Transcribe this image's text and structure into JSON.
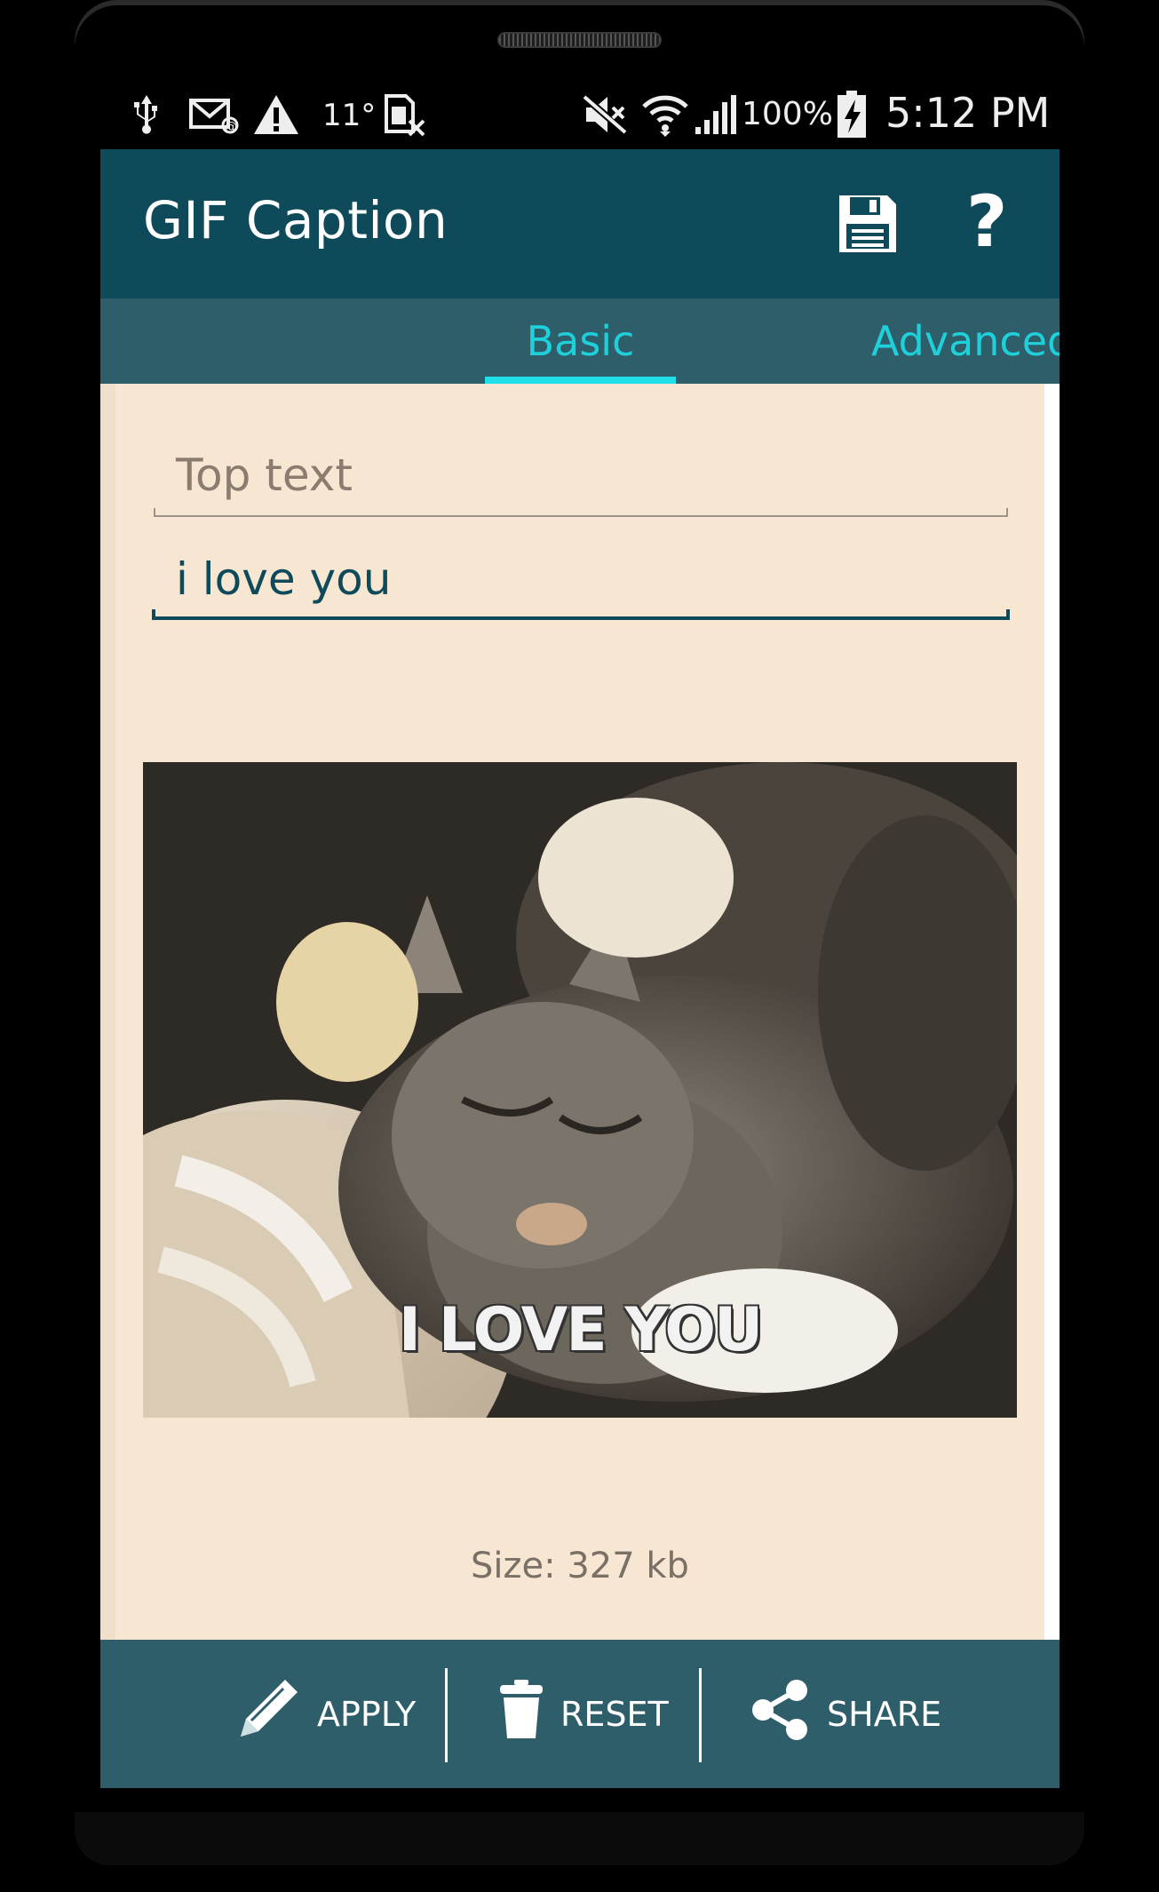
{
  "status_bar": {
    "temperature": "11°",
    "battery": "100%",
    "time": "5:12 PM",
    "icons": [
      "usb-icon",
      "email-icon",
      "warning-icon",
      "sim-off-icon",
      "mute-icon",
      "wifi-icon",
      "signal-icon",
      "battery-charging-icon"
    ]
  },
  "app_bar": {
    "title": "GIF Caption",
    "actions": [
      "save-icon",
      "help-icon"
    ],
    "help_glyph": "?"
  },
  "tabs": {
    "basic": "Basic",
    "advanced": "Advanced",
    "selected": "Basic"
  },
  "form": {
    "top_text": {
      "placeholder": "Top text",
      "value": ""
    },
    "bottom_text": {
      "value": "i love you"
    }
  },
  "preview": {
    "caption": "I LOVE YOU"
  },
  "size_label": "Size: 327 kb",
  "bottom_bar": {
    "apply": "APPLY",
    "reset": "RESET",
    "share": "SHARE"
  },
  "colors": {
    "app_bar": "#0e4a5a",
    "tab_bar": "#2e5e6a",
    "accent": "#1fe0e8",
    "background": "#f6e6d2"
  }
}
